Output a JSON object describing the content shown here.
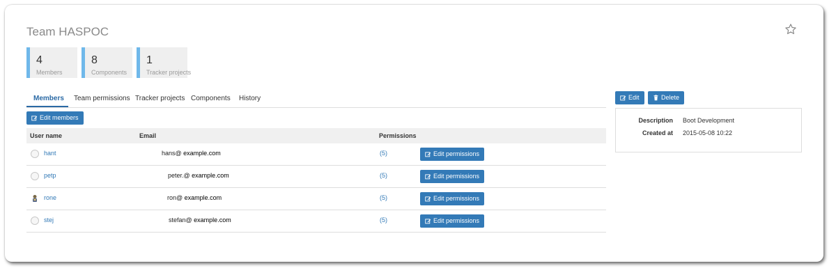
{
  "page": {
    "title": "Team HASPOC",
    "favorite_icon": "star-outline-icon"
  },
  "stats": [
    {
      "value": "4",
      "label": "Members"
    },
    {
      "value": "8",
      "label": "Components"
    },
    {
      "value": "1",
      "label": "Tracker projects"
    }
  ],
  "accent_color": "#6fb8ea",
  "button_color": "#337ab7",
  "tabs": [
    {
      "label": "Members",
      "active": true
    },
    {
      "label": "Team permissions",
      "active": false
    },
    {
      "label": "Tracker projects",
      "active": false
    },
    {
      "label": "Components",
      "active": false
    },
    {
      "label": "History",
      "active": false
    }
  ],
  "toolbar": {
    "edit_members_label": "Edit members"
  },
  "table": {
    "columns": [
      "User name",
      "Email",
      "Permissions"
    ],
    "rows": [
      {
        "user": "hant",
        "email_local": "hans",
        "email_domain": " example.com",
        "permissions": "(5)",
        "action": "Edit permissions",
        "avatar": "default-avatar-icon"
      },
      {
        "user": "petp",
        "email_local": "peter.",
        "email_domain": " example.com",
        "permissions": "(5)",
        "action": "Edit permissions",
        "avatar": "default-avatar-icon"
      },
      {
        "user": "rone",
        "email_local": "ron",
        "email_domain": " example.com",
        "permissions": "(5)",
        "action": "Edit permissions",
        "avatar": "custom-avatar-icon"
      },
      {
        "user": "stej",
        "email_local": "stefan",
        "email_domain": " example.com",
        "permissions": "(5)",
        "action": "Edit permissions",
        "avatar": "default-avatar-icon"
      }
    ]
  },
  "side_panel": {
    "edit_label": "Edit",
    "delete_label": "Delete",
    "details": [
      {
        "key": "Description",
        "value": "Boot Development"
      },
      {
        "key": "Created at",
        "value": "2015-05-08 10:22"
      }
    ]
  }
}
